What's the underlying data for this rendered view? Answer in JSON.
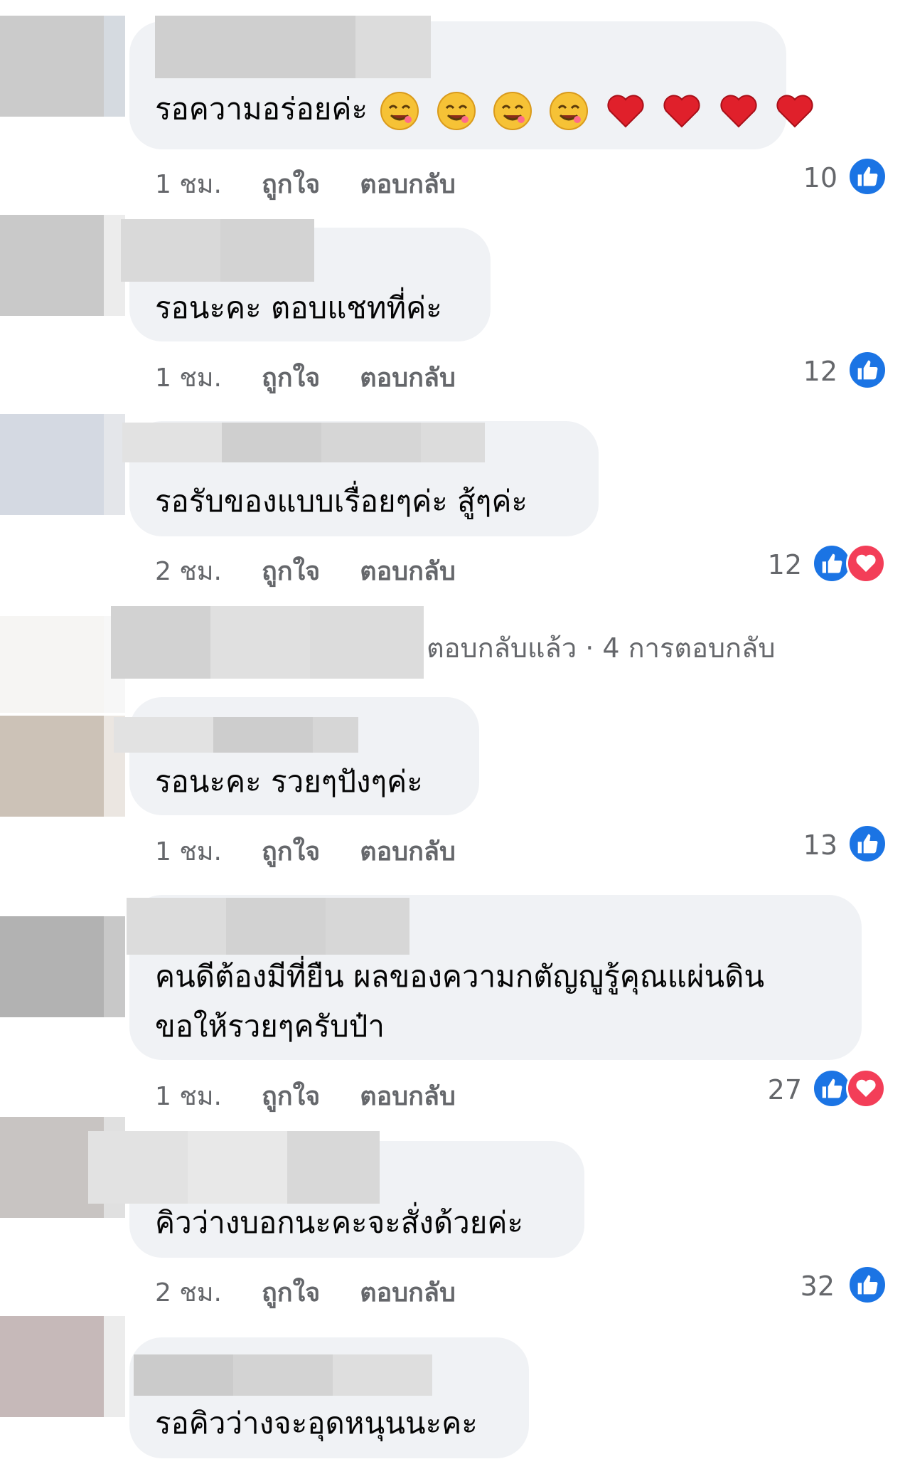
{
  "colors": {
    "bubble": "#f0f2f5",
    "meta_text": "#65676b",
    "like_blue": "#1b74e4",
    "love_red": "#f33e58"
  },
  "comments": [
    {
      "text": "รอความอร่อยค่ะ",
      "emojis": [
        "smiling-face-icon",
        "smiling-face-icon",
        "smiling-face-icon",
        "smiling-face-icon",
        "red-heart-icon",
        "red-heart-icon",
        "red-heart-icon",
        "red-heart-icon"
      ],
      "time": "1 ชม.",
      "like_label": "ถูกใจ",
      "reply_label": "ตอบกลับ",
      "reaction_count": "10",
      "reactions": [
        "like-icon"
      ]
    },
    {
      "text": "รอนะคะ ตอบแชทที่ค่ะ",
      "time": "1 ชม.",
      "like_label": "ถูกใจ",
      "reply_label": "ตอบกลับ",
      "reaction_count": "12",
      "reactions": [
        "like-icon"
      ]
    },
    {
      "text": "รอรับของแบบเรื่อยๆค่ะ สู้ๆค่ะ",
      "time": "2 ชม.",
      "like_label": "ถูกใจ",
      "reply_label": "ตอบกลับ",
      "reaction_count": "12",
      "reactions": [
        "like-icon",
        "love-icon"
      ],
      "replies_text": "ตอบกลับแล้ว · 4 การตอบกลับ"
    },
    {
      "text": "รอนะคะ รวยๆปังๆค่ะ",
      "time": "1 ชม.",
      "like_label": "ถูกใจ",
      "reply_label": "ตอบกลับ",
      "reaction_count": "13",
      "reactions": [
        "like-icon"
      ]
    },
    {
      "text_line1": "คนดีต้องมีที่ยืน ผลของความกตัญญูรู้คุณแผ่นดิน",
      "text_line2": "ขอให้รวยๆครับป๋า",
      "time": "1 ชม.",
      "like_label": "ถูกใจ",
      "reply_label": "ตอบกลับ",
      "reaction_count": "27",
      "reactions": [
        "like-icon",
        "love-icon"
      ]
    },
    {
      "text": "คิวว่างบอกนะคะจะสั่งด้วยค่ะ",
      "time": "2 ชม.",
      "like_label": "ถูกใจ",
      "reply_label": "ตอบกลับ",
      "reaction_count": "32",
      "reactions": [
        "like-icon"
      ]
    },
    {
      "text": "รอคิวว่างจะอุดหนุนนะคะ"
    }
  ]
}
